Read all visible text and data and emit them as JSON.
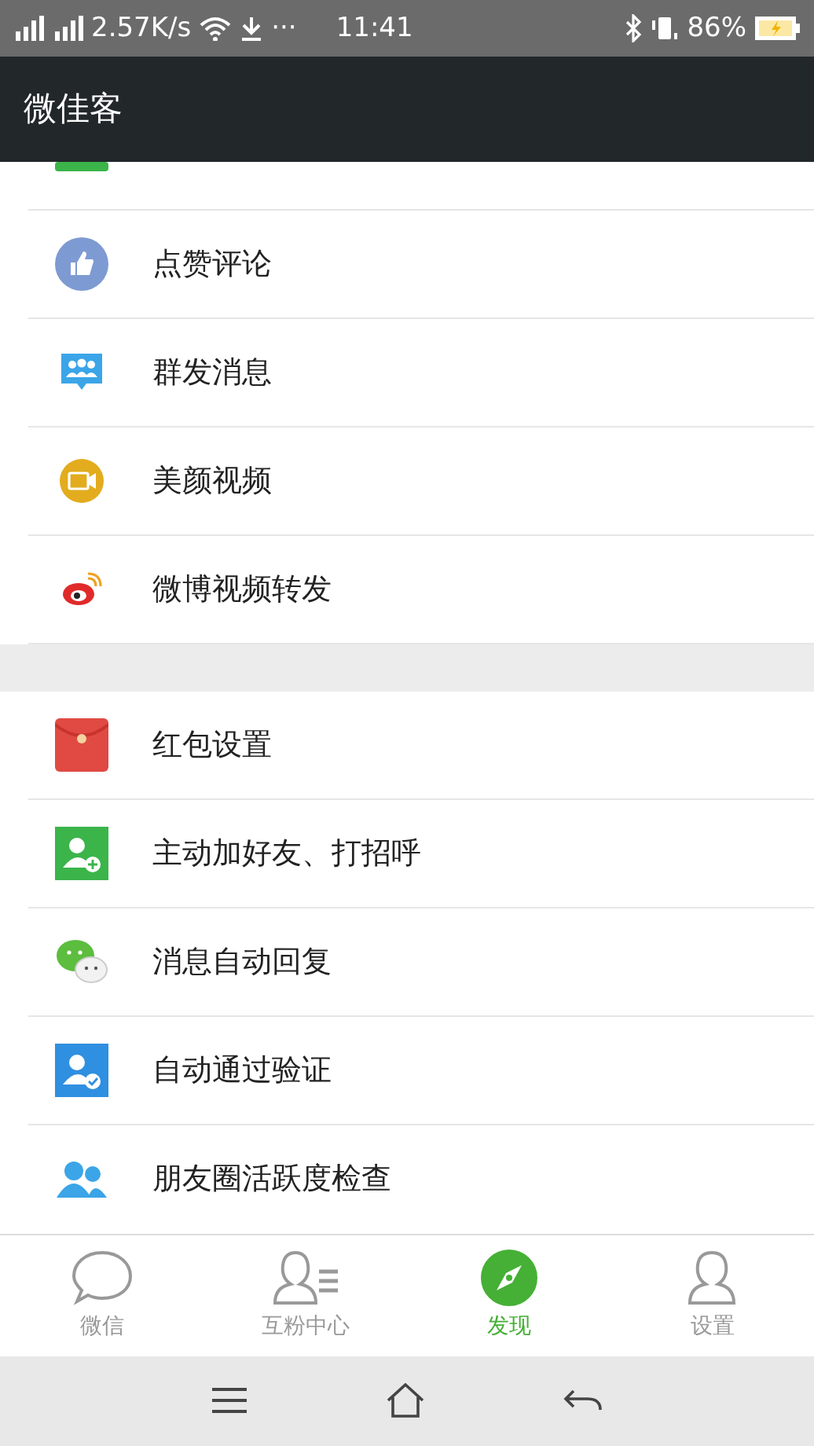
{
  "status_bar": {
    "speed": "2.57K/s",
    "more": "···",
    "time": "11:41",
    "battery": "86%"
  },
  "header": {
    "title": "微佳客"
  },
  "sections": [
    {
      "items": [
        {
          "label": "点赞评论",
          "kind": "thumb"
        },
        {
          "label": "群发消息",
          "kind": "group"
        },
        {
          "label": "美颜视频",
          "kind": "video"
        },
        {
          "label": "微博视频转发",
          "kind": "weibo"
        }
      ]
    },
    {
      "items": [
        {
          "label": "红包设置",
          "kind": "redpacket"
        },
        {
          "label": "主动加好友、打招呼",
          "kind": "addfriend"
        },
        {
          "label": "消息自动回复",
          "kind": "chat"
        },
        {
          "label": "自动通过验证",
          "kind": "verify"
        },
        {
          "label": "朋友圈活跃度检查",
          "kind": "friends"
        }
      ]
    }
  ],
  "tabs": [
    {
      "label": "微信",
      "kind": "bubble",
      "selected": false
    },
    {
      "label": "互粉中心",
      "kind": "contacts",
      "selected": false
    },
    {
      "label": "发现",
      "kind": "compass",
      "selected": true
    },
    {
      "label": "设置",
      "kind": "person",
      "selected": false
    }
  ]
}
